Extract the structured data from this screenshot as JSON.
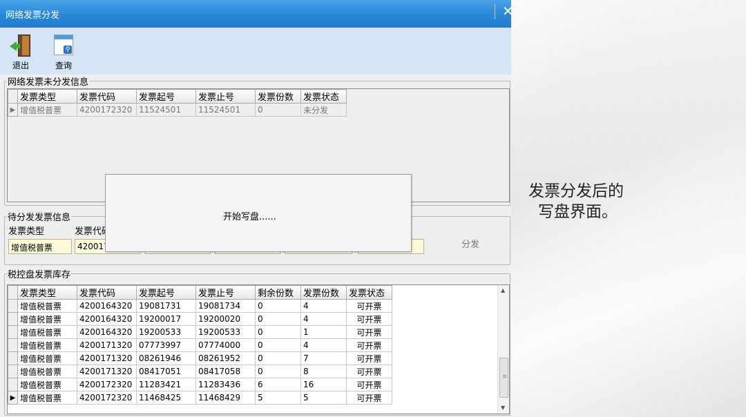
{
  "window": {
    "title": "网络发票分发",
    "close_glyph": "✕"
  },
  "toolbar": {
    "exit_label": "退出",
    "query_label": "查询"
  },
  "undistributed": {
    "legend": "网络发票未分发信息",
    "columns": [
      "发票类型",
      "发票代码",
      "发票起号",
      "发票止号",
      "发票份数",
      "发票状态"
    ],
    "rows": [
      [
        "增值税普票",
        "4200172320",
        "11524501",
        "11524501",
        "0",
        "未分发"
      ]
    ]
  },
  "pending": {
    "legend": "待分发发票信息",
    "type_label": "发票类型",
    "code_label": "发票代码",
    "type_value": "增值税普票",
    "code_value": "420017",
    "distribute_button": "分发"
  },
  "dialog": {
    "message": "开始写盘......"
  },
  "stock": {
    "legend": "税控盘发票库存",
    "columns": [
      "发票类型",
      "发票代码",
      "发票起号",
      "发票止号",
      "剩余份数",
      "发票份数",
      "发票状态"
    ],
    "rows": [
      [
        "增值税普票",
        "4200164320",
        "19081731",
        "19081734",
        "0",
        "4",
        "可开票"
      ],
      [
        "增值税普票",
        "4200164320",
        "19200017",
        "19200020",
        "0",
        "4",
        "可开票"
      ],
      [
        "增值税普票",
        "4200164320",
        "19200533",
        "19200533",
        "0",
        "1",
        "可开票"
      ],
      [
        "增值税普票",
        "4200171320",
        "07773997",
        "07774000",
        "0",
        "4",
        "可开票"
      ],
      [
        "增值税普票",
        "4200171320",
        "08261946",
        "08261952",
        "0",
        "7",
        "可开票"
      ],
      [
        "增值税普票",
        "4200171320",
        "08417051",
        "08417058",
        "0",
        "8",
        "可开票"
      ],
      [
        "增值税普票",
        "4200172320",
        "11283421",
        "11283436",
        "6",
        "16",
        "可开票"
      ],
      [
        "增值税普票",
        "4200172320",
        "11468425",
        "11468429",
        "5",
        "5",
        "可开票"
      ]
    ],
    "selected_row": 7
  },
  "caption": {
    "line1": "发票分发后的",
    "line2": "写盘界面。"
  }
}
